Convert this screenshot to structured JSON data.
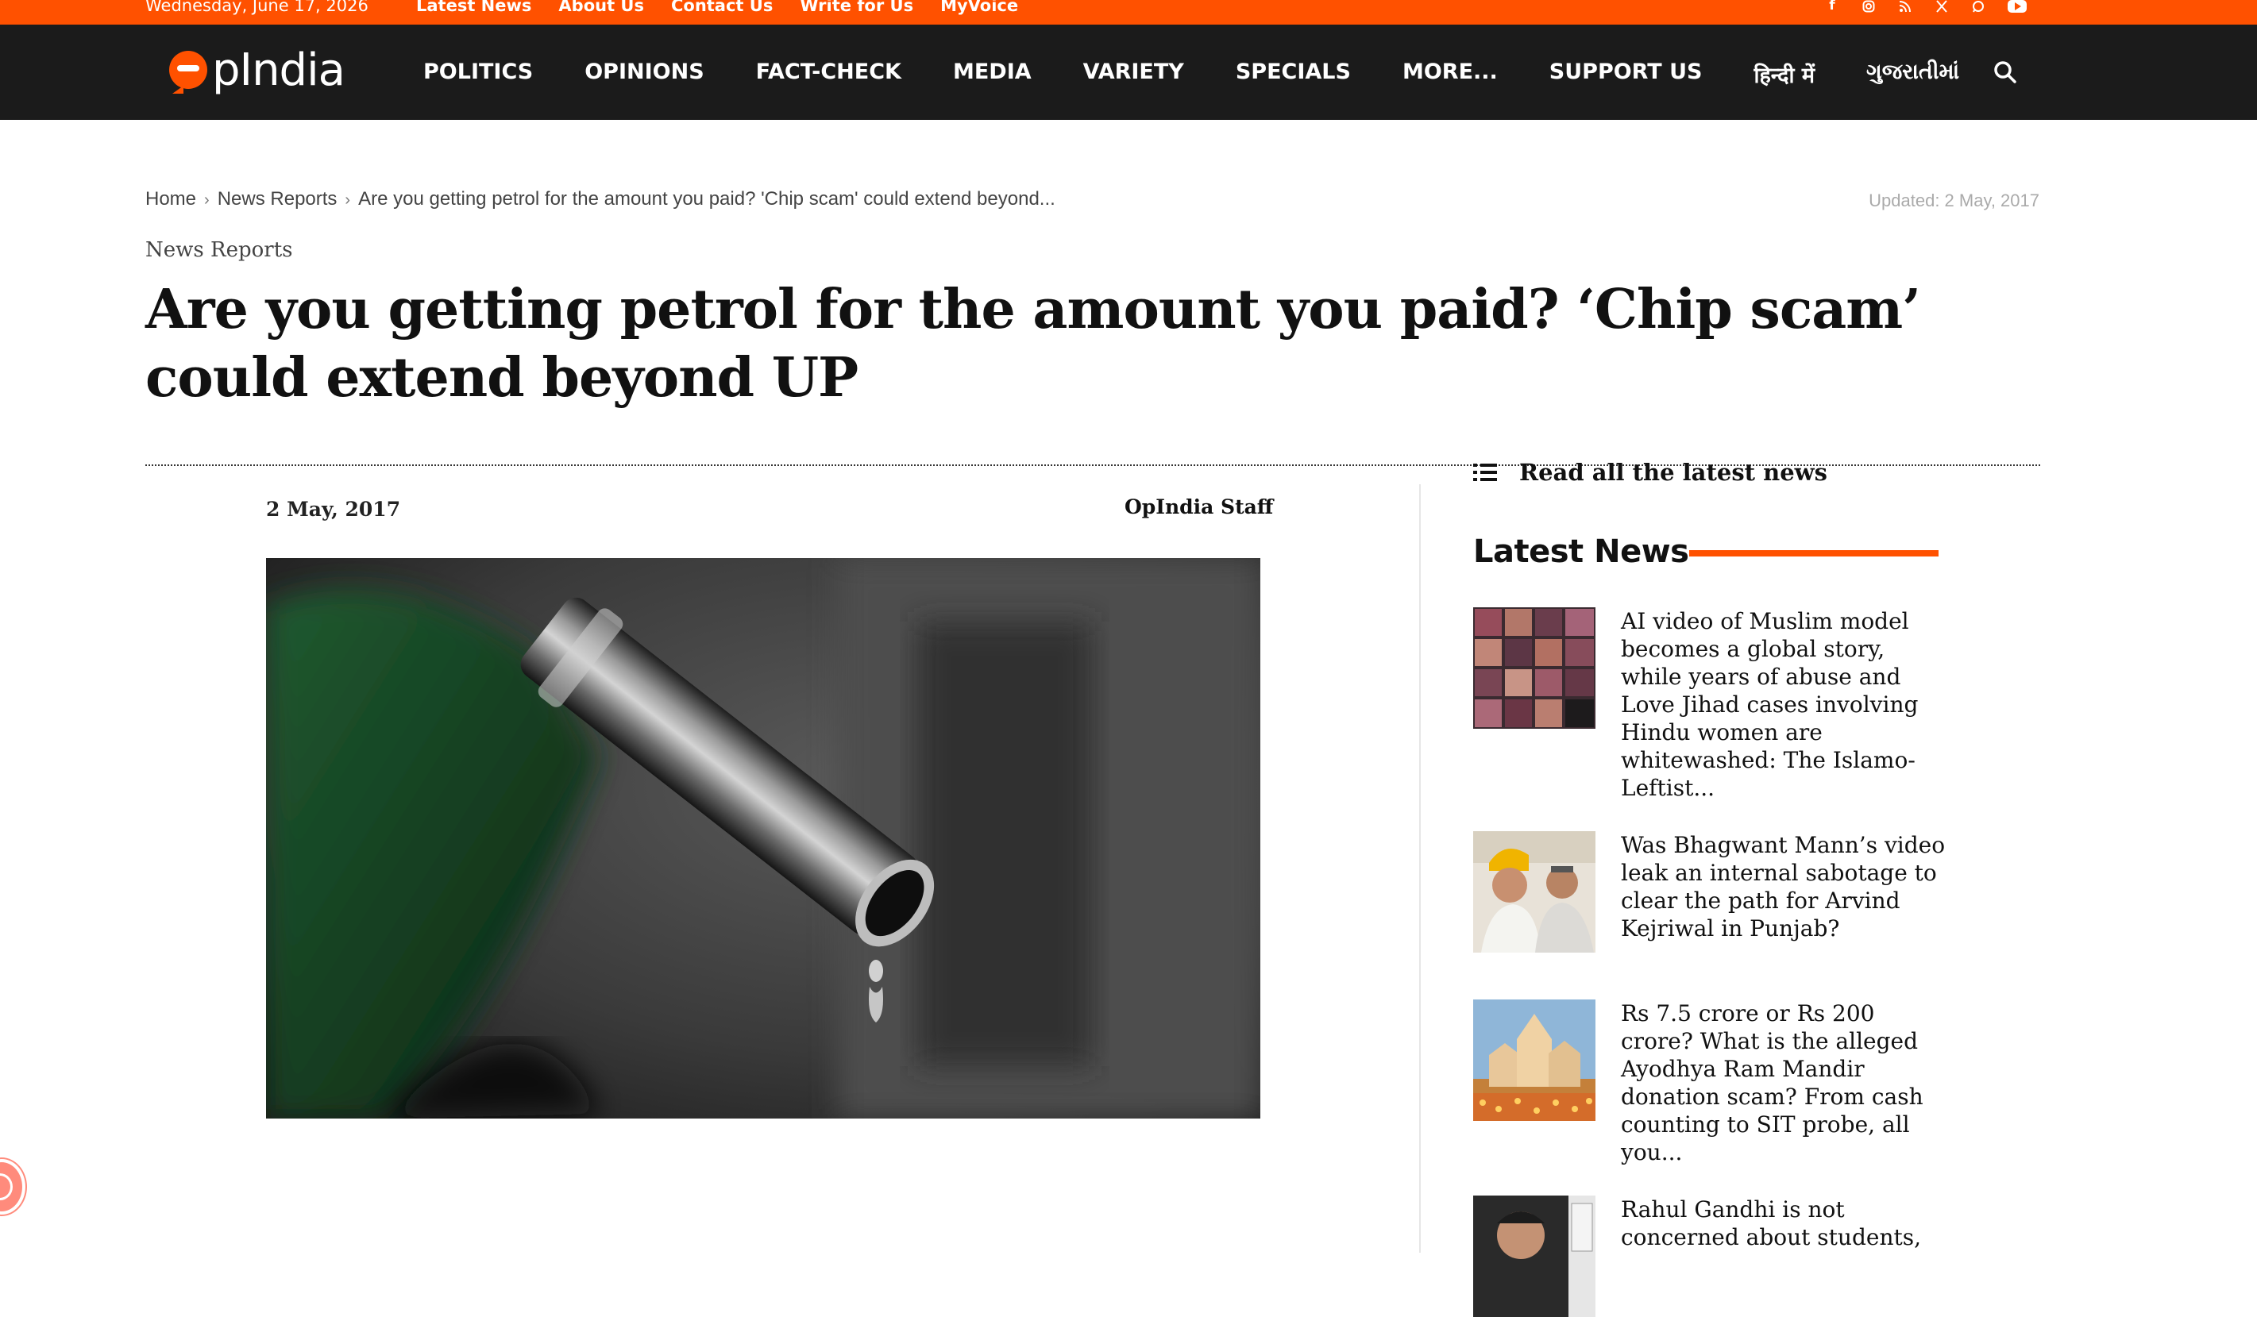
{
  "topbar": {
    "date": "Wednesday, June 17, 2026",
    "links": [
      "Latest News",
      "About Us",
      "Contact Us",
      "Write for Us",
      "MyVoice"
    ],
    "socials": [
      "facebook-icon",
      "instagram-icon",
      "rss-icon",
      "x-icon",
      "whatsapp-icon",
      "youtube-icon"
    ]
  },
  "header": {
    "logo_text": "pIndia",
    "nav": [
      "POLITICS",
      "OPINIONS",
      "FACT-CHECK",
      "MEDIA",
      "VARIETY",
      "SPECIALS",
      "MORE...",
      "SUPPORT US",
      "हिन्दी में",
      "ગુજરાતીમાં"
    ]
  },
  "breadcrumb": {
    "home": "Home",
    "section": "News Reports",
    "current": "Are you getting petrol for the amount you paid? 'Chip scam' could extend beyond..."
  },
  "updated": "Updated: 2 May, 2017",
  "article": {
    "category": "News Reports",
    "title": "Are you getting petrol for the amount you paid? ‘Chip scam’ could extend beyond UP",
    "date": "2 May, 2017",
    "author": "OpIndia Staff"
  },
  "sidebar": {
    "read_all": "Read all the latest news",
    "latest_heading": "Latest News",
    "items": [
      {
        "text": "AI video of Muslim model becomes a global story, while years of abuse and Love Jihad cases involving Hindu women are whitewashed: The Islamo-Leftist..."
      },
      {
        "text": "Was Bhagwant Mann’s video leak an internal sabotage to clear the path for Arvind Kejriwal in Punjab?"
      },
      {
        "text": "Rs 7.5 crore or Rs 200 crore? What is the alleged Ayodhya Ram Mandir donation scam? From cash counting to SIT probe, all you..."
      },
      {
        "text": "Rahul Gandhi is not concerned about students,"
      }
    ]
  },
  "colors": {
    "accent": "#ff5100",
    "header_bg": "#1b1b1b"
  }
}
